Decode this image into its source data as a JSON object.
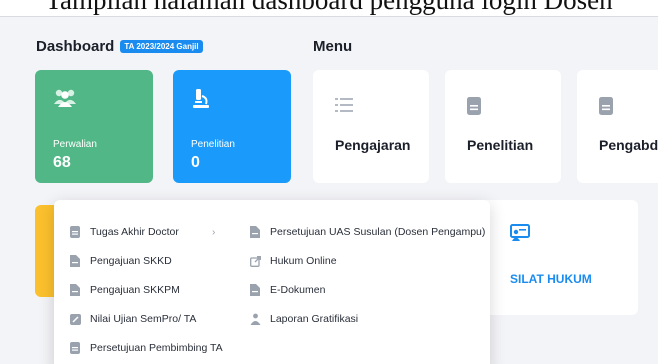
{
  "caption": "Tampilan halaman dashboard pengguna login Dosen",
  "dashboard": {
    "title": "Dashboard",
    "badge": "TA 2023/2024 Ganjil",
    "stats": [
      {
        "label": "Perwalian",
        "value": "68",
        "color": "#52b787",
        "icon": "users-icon"
      },
      {
        "label": "Penelitian",
        "value": "0",
        "color": "#1a9bfb",
        "icon": "microscope-icon"
      }
    ]
  },
  "menu": {
    "title": "Menu",
    "cards": [
      {
        "label": "Pengajaran",
        "icon": "list-icon"
      },
      {
        "label": "Penelitian",
        "icon": "document-icon"
      },
      {
        "label": "Pengabdia",
        "icon": "document-icon"
      }
    ]
  },
  "dropdown": {
    "left": [
      {
        "label": "Tugas Akhir Doctor",
        "icon": "document-icon",
        "has_submenu": true
      },
      {
        "label": "Pengajuan SKKD",
        "icon": "file-icon"
      },
      {
        "label": "Pengajuan SKKPM",
        "icon": "file-icon"
      },
      {
        "label": "Nilai Ujian SemPro/ TA",
        "icon": "edit-icon"
      },
      {
        "label": "Persetujuan Pembimbing TA",
        "icon": "document-icon"
      }
    ],
    "right": [
      {
        "label": "Persetujuan UAS Susulan (Dosen Pengampu)",
        "icon": "file-icon"
      },
      {
        "label": "Hukum Online",
        "icon": "external-link-icon"
      },
      {
        "label": "E-Dokumen",
        "icon": "file-icon"
      },
      {
        "label": "Laporan Gratifikasi",
        "icon": "user-report-icon"
      }
    ]
  },
  "silat": {
    "label": "SILAT HUKUM",
    "icon": "presentation-icon"
  },
  "colors": {
    "accent": "#1a8cf0",
    "green": "#52b787",
    "blue": "#1a9bfb",
    "yellow": "#fbc02d"
  }
}
